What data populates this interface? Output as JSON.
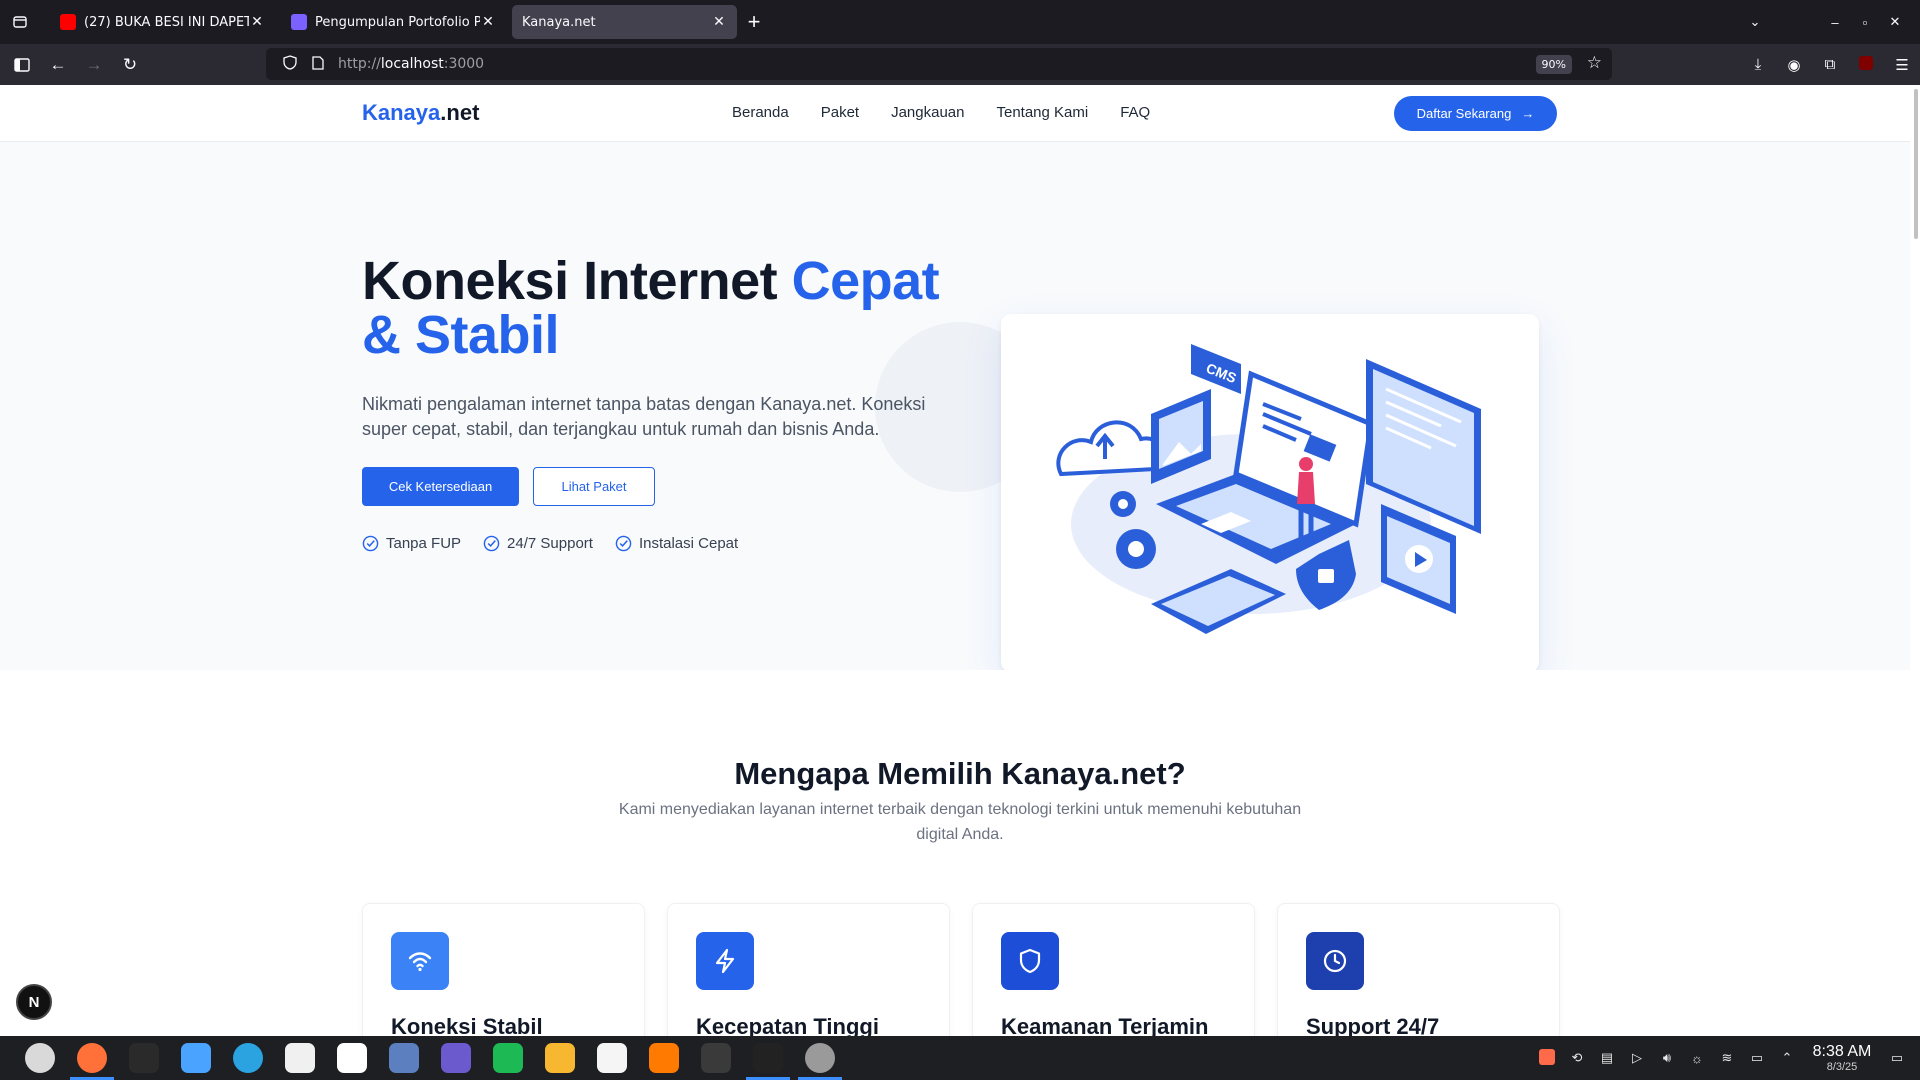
{
  "browser": {
    "tabs": [
      {
        "title": "(27) BUKA BESI INI DAPET",
        "favicon_color": "#ff0000",
        "active": false
      },
      {
        "title": "Pengumpulan Portofolio P",
        "favicon_color": "#7b61ff",
        "active": false
      },
      {
        "title": "Kanaya.net",
        "favicon_color": "",
        "active": true
      }
    ],
    "url_scheme": "http://",
    "url_host": "localhost",
    "url_rest": ":3000",
    "zoom": "90%"
  },
  "site": {
    "logo_main": "Kanaya",
    "logo_suffix": ".net",
    "nav": [
      "Beranda",
      "Paket",
      "Jangkauan",
      "Tentang Kami",
      "FAQ"
    ],
    "cta": "Daftar Sekarang",
    "hero": {
      "title_part1": "Koneksi Internet ",
      "title_part2": "Cepat & Stabil",
      "lead": "Nikmati pengalaman internet tanpa batas dengan Kanaya.net. Koneksi super cepat, stabil, dan terjangkau untuk rumah dan bisnis Anda.",
      "btn_primary": "Cek Ketersediaan",
      "btn_secondary": "Lihat Paket",
      "features": [
        "Tanpa FUP",
        "24/7 Support",
        "Instalasi Cepat"
      ],
      "illustration_label": "CMS"
    },
    "why": {
      "title": "Mengapa Memilih Kanaya.net?",
      "subtitle": "Kami menyediakan layanan internet terbaik dengan teknologi terkini untuk memenuhi kebutuhan digital Anda.",
      "cards": [
        {
          "title": "Koneksi Stabil",
          "icon": "wifi-icon",
          "color": "#3b82f6"
        },
        {
          "title": "Kecepatan Tinggi",
          "icon": "lightning-icon",
          "color": "#2563eb"
        },
        {
          "title": "Keamanan Terjamin",
          "icon": "shield-icon",
          "color": "#1d4ed8"
        },
        {
          "title": "Support 24/7",
          "icon": "clock-icon",
          "color": "#1e40af"
        }
      ]
    }
  },
  "dev_badge": "N",
  "taskbar": {
    "time": "8:38 AM",
    "date": "8/3/25"
  }
}
